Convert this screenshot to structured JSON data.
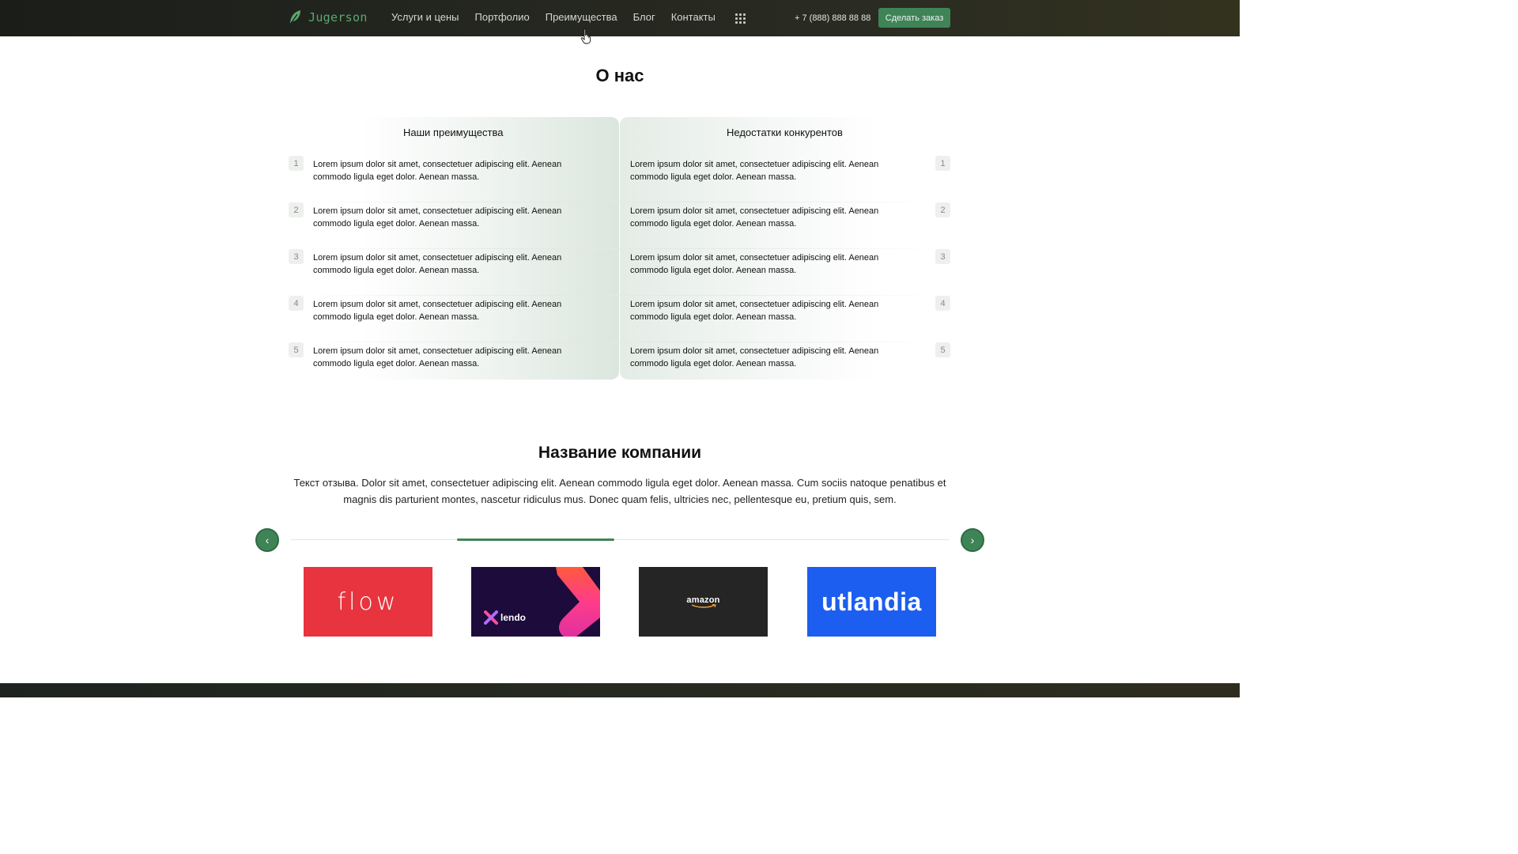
{
  "header": {
    "logo_text": "Jugerson",
    "nav": [
      "Услуги и цены",
      "Портфолио",
      "Преимущества",
      "Блог",
      "Контакты"
    ],
    "phone": "+ 7 (888) 888 88 88",
    "order_button": "Сделать заказ"
  },
  "about": {
    "title": "О нас",
    "left_heading": "Наши преимущества",
    "right_heading": "Недостатки конкурентов",
    "rows": [
      {
        "num": "1",
        "left": "Lorem ipsum dolor sit amet, consectetuer adipiscing elit. Aenean commodo ligula eget dolor. Aenean massa.",
        "right": "Lorem ipsum dolor sit amet, consectetuer adipiscing elit. Aenean commodo ligula eget dolor. Aenean massa."
      },
      {
        "num": "2",
        "left": "Lorem ipsum dolor sit amet, consectetuer adipiscing elit. Aenean commodo ligula eget dolor. Aenean massa.",
        "right": "Lorem ipsum dolor sit amet, consectetuer adipiscing elit. Aenean commodo ligula eget dolor. Aenean massa."
      },
      {
        "num": "3",
        "left": "Lorem ipsum dolor sit amet, consectetuer adipiscing elit. Aenean commodo ligula eget dolor. Aenean massa.",
        "right": "Lorem ipsum dolor sit amet, consectetuer adipiscing elit. Aenean commodo ligula eget dolor. Aenean massa."
      },
      {
        "num": "4",
        "left": "Lorem ipsum dolor sit amet, consectetuer adipiscing elit. Aenean commodo ligula eget dolor. Aenean massa.",
        "right": "Lorem ipsum dolor sit amet, consectetuer adipiscing elit. Aenean commodo ligula eget dolor. Aenean massa."
      },
      {
        "num": "5",
        "left": "Lorem ipsum dolor sit amet, consectetuer adipiscing elit. Aenean commodo ligula eget dolor. Aenean massa.",
        "right": "Lorem ipsum dolor sit amet, consectetuer adipiscing elit. Aenean commodo ligula eget dolor. Aenean massa."
      }
    ]
  },
  "testimonial": {
    "company": "Название компании",
    "text": "Текст отзыва. Dolor sit amet, consectetuer adipiscing elit. Aenean commodo ligula eget dolor. Aenean massa. Cum sociis natoque penatibus et magnis dis parturient montes, nascetur ridiculus mus. Donec quam felis, ultricies nec, pellentesque eu, pretium quis, sem.",
    "prev_icon": "chevron-left-icon",
    "next_icon": "chevron-right-icon",
    "prev_glyph": "‹",
    "next_glyph": "›"
  },
  "clients": [
    {
      "name": "flow",
      "color": "#e8343f"
    },
    {
      "name": "lendo",
      "color": "#1d0b3c"
    },
    {
      "name": "amazon",
      "color": "#252525"
    },
    {
      "name": "utlandia",
      "color": "#1b5ef0"
    }
  ],
  "colors": {
    "accent": "#3f8456",
    "logo": "#5aa86d",
    "header_bg": "#1b1d19"
  }
}
